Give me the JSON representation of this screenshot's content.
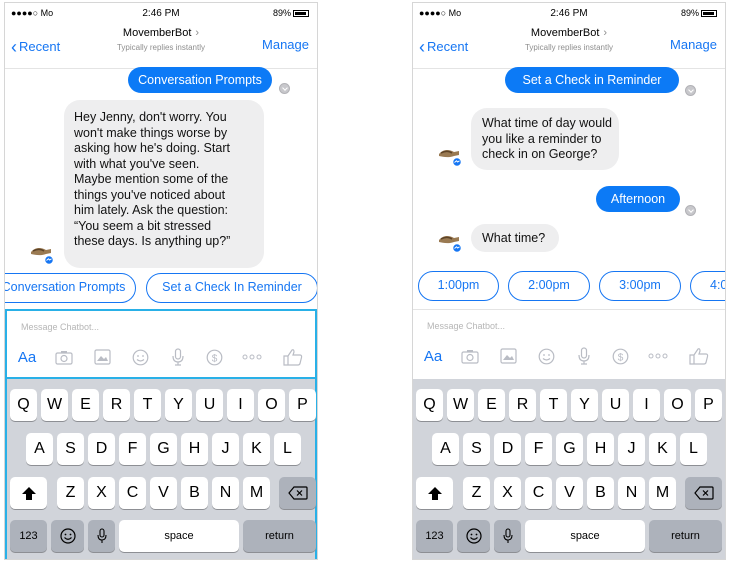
{
  "phones": [
    {
      "status": {
        "carrier": "●●●●○ Mo",
        "time": "2:46 PM",
        "battery": "89%"
      },
      "nav": {
        "back": "Recent",
        "title": "MovemberBot",
        "subtitle": "Typically replies instantly",
        "action": "Manage"
      },
      "messages": [
        {
          "from": "user",
          "text": "Conversation Prompts"
        },
        {
          "from": "bot",
          "lines": [
            "Hey Jenny, don't worry. You",
            "won't make things worse by",
            "asking how he's doing. Start",
            "with what you've seen.",
            "Maybe mention some of the",
            "things you've noticed about",
            "him lately. Ask the question:",
            "“You seem a bit stressed",
            "these days. Is anything up?”"
          ]
        }
      ],
      "quick_replies": [
        "Conversation Prompts",
        "Set a Check In Reminder"
      ],
      "composer": {
        "placeholder": "Message Chatbot...",
        "aa": "Aa"
      }
    },
    {
      "status": {
        "carrier": "●●●●○ Mo",
        "time": "2:46 PM",
        "battery": "89%"
      },
      "nav": {
        "back": "Recent",
        "title": "MovemberBot",
        "subtitle": "Typically replies instantly",
        "action": "Manage"
      },
      "messages": [
        {
          "from": "user",
          "text": "Set a Check in Reminder"
        },
        {
          "from": "bot",
          "lines": [
            "What time of day would",
            "you like a reminder to",
            "check in on George?"
          ]
        },
        {
          "from": "user",
          "text": "Afternoon"
        },
        {
          "from": "bot",
          "lines": [
            "What time?"
          ]
        }
      ],
      "quick_replies": [
        "1:00pm",
        "2:00pm",
        "3:00pm",
        "4:0"
      ],
      "composer": {
        "placeholder": "Message Chatbot...",
        "aa": "Aa"
      }
    }
  ],
  "keyboard": {
    "row1": [
      "Q",
      "W",
      "E",
      "R",
      "T",
      "Y",
      "U",
      "I",
      "O",
      "P"
    ],
    "row2": [
      "A",
      "S",
      "D",
      "F",
      "G",
      "H",
      "J",
      "K",
      "L"
    ],
    "row3": [
      "Z",
      "X",
      "C",
      "V",
      "B",
      "N",
      "M"
    ],
    "num": "123",
    "space": "space",
    "return": "return"
  },
  "icons": [
    "camera-icon",
    "photo-icon",
    "emoji-icon",
    "mic-icon",
    "payment-icon",
    "more-icon",
    "like-icon",
    "shift-icon",
    "delete-icon",
    "globe-emoji-icon"
  ],
  "colors": {
    "accent": "#1676f3",
    "bubble_out": "#0c7af6",
    "bubble_in": "#eeeeef",
    "focus": "#29b0e7",
    "keyboard": "#d1d4da"
  }
}
